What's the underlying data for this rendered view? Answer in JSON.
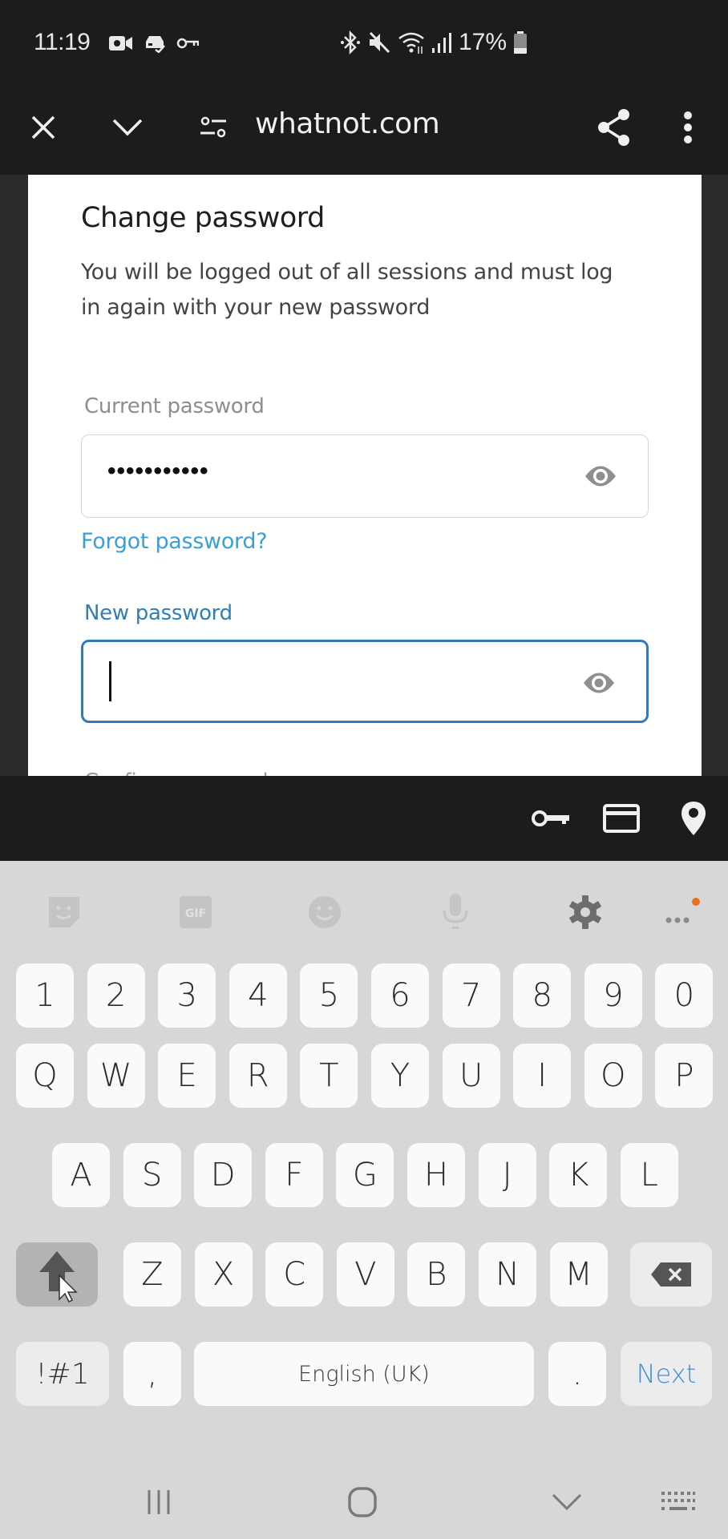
{
  "status_bar": {
    "time": "11:19",
    "left_icons": [
      "video-record-icon",
      "car-sync-icon",
      "vpn-key-icon"
    ],
    "right_icons": [
      "bluetooth-icon",
      "mute-icon",
      "wifi-icon",
      "signal-icon"
    ],
    "battery_percent": "17%"
  },
  "browser": {
    "url": "whatnot.com",
    "close_label": "Close",
    "minimize_label": "Minimize",
    "site_settings_label": "Site settings",
    "share_label": "Share",
    "menu_label": "More options"
  },
  "page": {
    "title": "Change password",
    "description": "You will be logged out of all sessions and must log in again with your new password",
    "current_password": {
      "label": "Current password",
      "value": "•••••••••••"
    },
    "forgot_password_link": "Forgot password?",
    "new_password": {
      "label": "New password",
      "value": ""
    },
    "confirm_password": {
      "label": "Confirm password"
    }
  },
  "autofill_bar": {
    "icons": [
      "key-icon",
      "credit-card-icon",
      "location-pin-icon"
    ]
  },
  "keyboard": {
    "toolbar": [
      "sticker-icon",
      "gif-icon",
      "emoji-icon",
      "microphone-icon",
      "settings-icon",
      "more-icon"
    ],
    "gif_text": "GIF",
    "row_numbers": [
      "1",
      "2",
      "3",
      "4",
      "5",
      "6",
      "7",
      "8",
      "9",
      "0"
    ],
    "row_1": [
      "Q",
      "W",
      "E",
      "R",
      "T",
      "Y",
      "U",
      "I",
      "O",
      "P"
    ],
    "row_2": [
      "A",
      "S",
      "D",
      "F",
      "G",
      "H",
      "J",
      "K",
      "L"
    ],
    "row_3": [
      "Z",
      "X",
      "C",
      "V",
      "B",
      "N",
      "M"
    ],
    "symbols_key": "!#1",
    "comma_key": ",",
    "space_key": "English (UK)",
    "period_key": ".",
    "action_key": "Next",
    "accent_color": "#3b8fd8",
    "notification_dot_color": "#e8711c"
  },
  "nav_bar": {
    "buttons": [
      "recent-apps",
      "home",
      "hide-keyboard",
      "keyboard-switch"
    ]
  },
  "colors": {
    "link": "#3a9fd4",
    "focus_border": "#2e7bbf",
    "focus_label": "#2f7fb6"
  }
}
